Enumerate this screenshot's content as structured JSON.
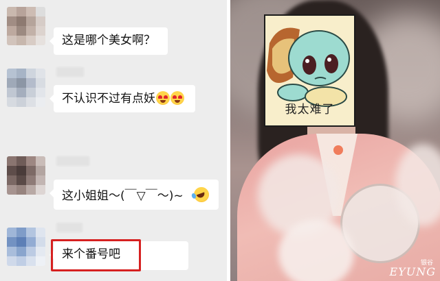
{
  "chat": {
    "messages": [
      {
        "text": "这是哪个美女啊？"
      },
      {
        "text": "不认识不过有点妖",
        "emoji": [
          "heart-eyes-emoji",
          "heart-eyes-emoji"
        ]
      },
      {
        "text": "这小姐姐～(￣▽￣～)~",
        "emoji": [
          "laughing-emoji"
        ]
      },
      {
        "text": "来个番号吧"
      }
    ]
  },
  "photo": {
    "sticker_text": "我太难了",
    "watermark": "EYUNG",
    "watermark_small": "银谷"
  },
  "colors": {
    "chat_background": "#ededed",
    "bubble": "#ffffff",
    "highlight_box": "#d62020"
  }
}
